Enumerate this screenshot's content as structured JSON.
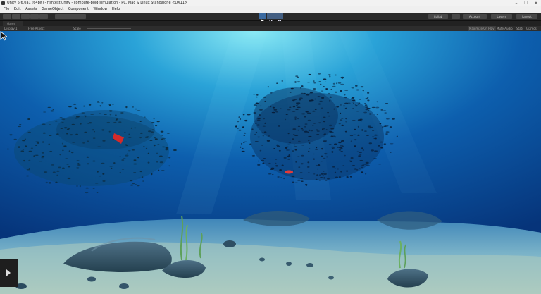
{
  "window": {
    "title": "Unity 5.6.0a1 (64bit) - fishtest.unity - compute-boid-simulation - PC, Mac & Linux Standalone <DX11>",
    "controls": [
      "–",
      "❐",
      "✕"
    ]
  },
  "menu": [
    "File",
    "Edit",
    "Assets",
    "GameObject",
    "Component",
    "Window",
    "Help"
  ],
  "toolbar": {
    "collab": "Collab",
    "account": "Account",
    "layers": "Layers",
    "layout": "Layout"
  },
  "tab": {
    "label": "Game"
  },
  "gamebar": {
    "display": "Display 1",
    "aspect": "Free Aspect",
    "scale_label": "Scale",
    "maximize": "Maximize On Play",
    "mute": "Mute Audio",
    "stats": "Stats",
    "gizmos": "Gizmos"
  },
  "colors": {
    "accent": "#3b6aa0",
    "water_top": "#6fe0f2",
    "water_mid": "#0a4f9a"
  },
  "icons": {
    "play": "play-icon",
    "pause": "pause-icon",
    "step": "step-icon",
    "video": "video-play-icon",
    "cursor": "mouse-cursor-icon"
  }
}
